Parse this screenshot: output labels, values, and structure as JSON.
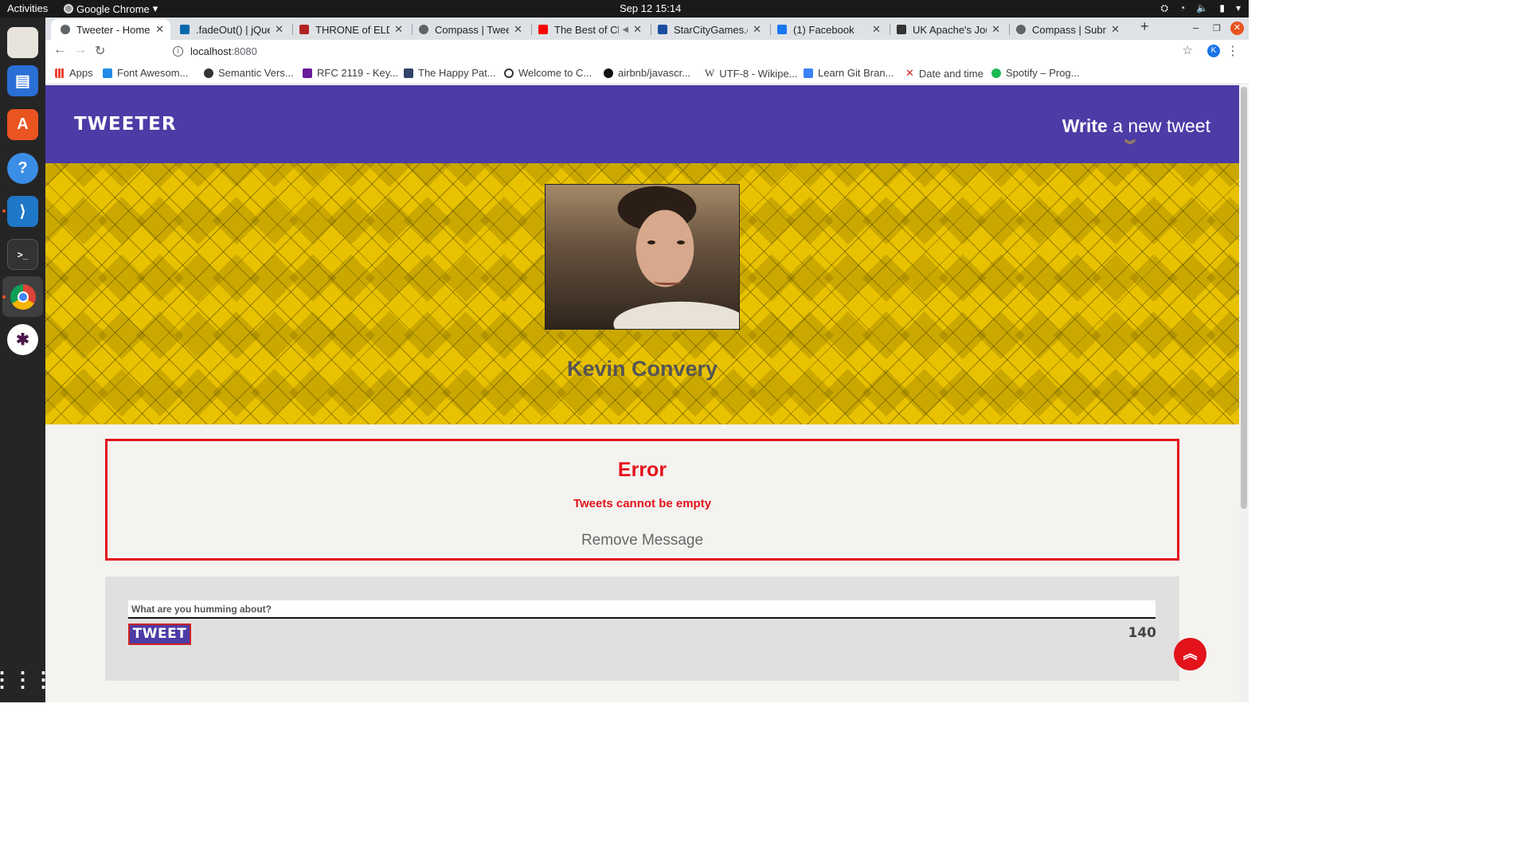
{
  "system": {
    "activities": "Activities",
    "app_name": "Google Chrome",
    "clock": "Sep 12  15:14"
  },
  "browser": {
    "tabs": [
      {
        "title": "Tweeter - Home P",
        "favicon_color": "#5f6368"
      },
      {
        "title": ".fadeOut() | jQuer",
        "favicon_color": "#0769ad"
      },
      {
        "title": "THRONE of ELDR",
        "favicon_color": "#b22222"
      },
      {
        "title": "Compass | Tweete",
        "favicon_color": "#5f6368"
      },
      {
        "title": "The Best of Ch",
        "favicon_color": "#ff0000"
      },
      {
        "title": "StarCityGames.co",
        "favicon_color": "#1a4fa0"
      },
      {
        "title": "(1) Facebook",
        "favicon_color": "#1877f2"
      },
      {
        "title": "UK Apache's Jour",
        "favicon_color": "#333333"
      },
      {
        "title": "Compass | Submi",
        "favicon_color": "#5f6368"
      }
    ],
    "url_host": "localhost",
    "url_port": ":8080",
    "profile_initial": "K",
    "bookmarks": [
      {
        "label": "Apps",
        "icon_color": "#ea4335"
      },
      {
        "label": "Font Awesom...",
        "icon_color": "#228ae6"
      },
      {
        "label": "Semantic Vers...",
        "icon_color": "#333333"
      },
      {
        "label": "RFC 2119 - Key...",
        "icon_color": "#6a1b9a"
      },
      {
        "label": "The Happy Pat...",
        "icon_color": "#334466"
      },
      {
        "label": "Welcome to C...",
        "icon_color": "#333333"
      },
      {
        "label": "airbnb/javascr...",
        "icon_color": "#111111"
      },
      {
        "label": "UTF-8 - Wikipe...",
        "icon_color": "#777777"
      },
      {
        "label": "Learn Git Bran...",
        "icon_color": "#3b82f6"
      },
      {
        "label": "Date and time",
        "icon_color": "#cc2222"
      },
      {
        "label": "Spotify – Prog...",
        "icon_color": "#1db954"
      }
    ]
  },
  "app": {
    "brand": "TWEETER",
    "compose_bold": "Write",
    "compose_rest": " a new tweet",
    "user_name": "Kevin Convery",
    "error": {
      "title": "Error",
      "message": "Tweets cannot be empty",
      "remove": "Remove Message"
    },
    "composer": {
      "placeholder": "What are you humming about?",
      "button": "TWEET",
      "counter": "140"
    },
    "colors": {
      "nav": "#4b3ca6",
      "accent": "#e3121b",
      "banner": "#e8c100"
    }
  }
}
